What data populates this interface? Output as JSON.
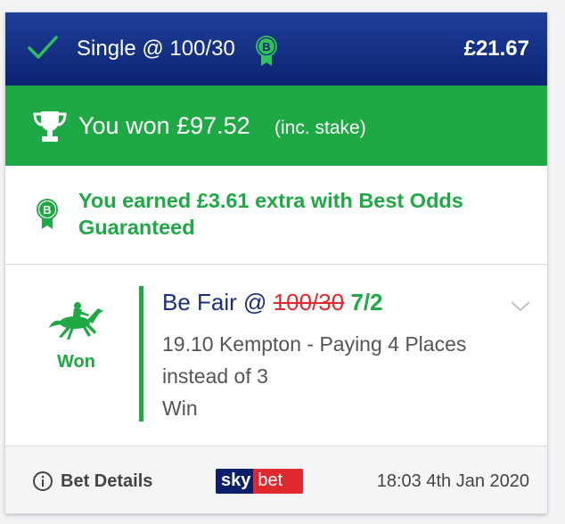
{
  "header": {
    "bet_type": "Single @ 100/30",
    "stake": "£21.67",
    "boost_badge_letter": "B",
    "icon": "check-icon"
  },
  "result": {
    "headline": "You won £97.52",
    "note": "(inc. stake)",
    "icon": "trophy-icon"
  },
  "best_odds": {
    "badge_letter": "B",
    "message": "You earned £3.61 extra with Best Odds Guaranteed"
  },
  "selection": {
    "status": "Won",
    "name": "Be Fair",
    "at": "@",
    "old_odds": "100/30",
    "new_odds": "7/2",
    "race": "19.10 Kempton - Paying 4 Places instead of 3",
    "market": "Win",
    "icon": "horse-racing-icon"
  },
  "footer": {
    "details_label": "Bet Details",
    "brand_sky": "sky",
    "brand_bet": "bet",
    "timestamp": "18:03 4th Jan 2020"
  },
  "colors": {
    "header_blue": "#0c2471",
    "win_green": "#1fa945",
    "strike_red": "#e0282f",
    "name_blue": "#1b2f7e"
  }
}
